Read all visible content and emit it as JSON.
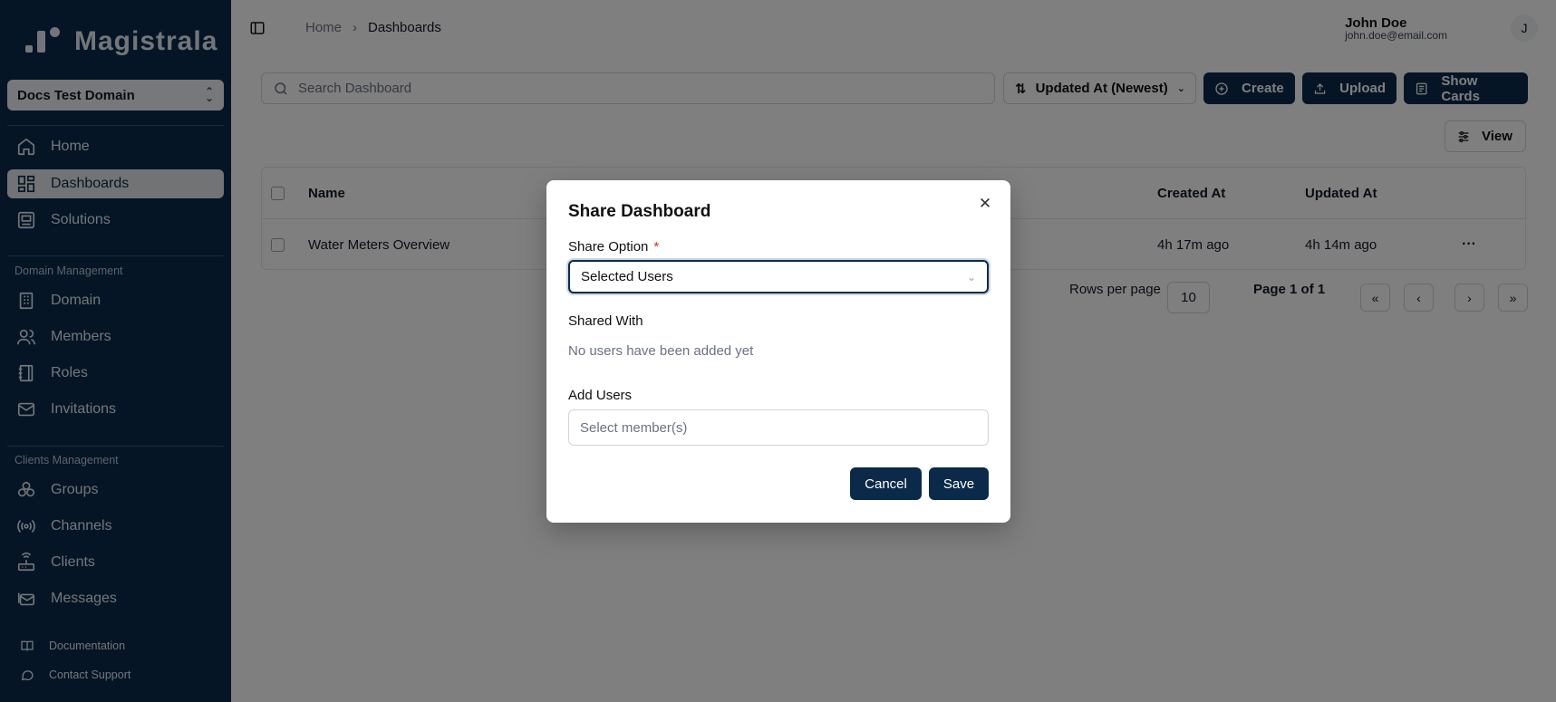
{
  "app": {
    "logo_text": "Magistrala"
  },
  "sidebar": {
    "domain": "Docs Test Domain",
    "main_items": [
      {
        "label": "Home",
        "icon": "home-icon"
      },
      {
        "label": "Dashboards",
        "icon": "dashboard-icon",
        "active": true
      },
      {
        "label": "Solutions",
        "icon": "solutions-icon"
      }
    ],
    "domain_section_label": "Domain Management",
    "domain_items": [
      {
        "label": "Domain",
        "icon": "building-icon"
      },
      {
        "label": "Members",
        "icon": "users-icon"
      },
      {
        "label": "Roles",
        "icon": "notebook-icon"
      },
      {
        "label": "Invitations",
        "icon": "mail-icon"
      }
    ],
    "clients_section_label": "Clients Management",
    "clients_items": [
      {
        "label": "Groups",
        "icon": "groups-icon"
      },
      {
        "label": "Channels",
        "icon": "radio-icon"
      },
      {
        "label": "Clients",
        "icon": "router-icon"
      },
      {
        "label": "Messages",
        "icon": "messages-icon"
      }
    ],
    "footer_items": [
      {
        "label": "Documentation",
        "icon": "book-icon"
      },
      {
        "label": "Contact Support",
        "icon": "chat-icon"
      }
    ]
  },
  "header": {
    "breadcrumb": [
      "Home",
      "Dashboards"
    ],
    "user_name": "John Doe",
    "user_email": "john.doe@email.com",
    "avatar_initial": "J"
  },
  "toolbar": {
    "search_placeholder": "Search Dashboard",
    "sort_label": "Updated At (Newest)",
    "create_label": "Create",
    "upload_label": "Upload",
    "show_cards_label": "Show Cards",
    "view_label": "View"
  },
  "table": {
    "headers": {
      "name": "Name",
      "created": "Created At",
      "updated": "Updated At"
    },
    "rows": [
      {
        "name": "Water Meters Overview",
        "created": "4h 17m ago",
        "updated": "4h 14m ago"
      }
    ]
  },
  "pagination": {
    "rows_per_page_label": "Rows per page",
    "rows_per_page": "10",
    "page_label": "Page 1 of 1"
  },
  "modal": {
    "title": "Share Dashboard",
    "share_option_label": "Share Option",
    "required_mark": "*",
    "share_option_value": "Selected Users",
    "shared_with_label": "Shared With",
    "shared_with_empty": "No users have been added yet",
    "add_users_label": "Add Users",
    "add_users_placeholder": "Select member(s)",
    "cancel_label": "Cancel",
    "save_label": "Save"
  },
  "colors": {
    "sidebar_bg": "#0b2a4a",
    "primary": "#0b2a4a",
    "required": "#dc2626"
  }
}
